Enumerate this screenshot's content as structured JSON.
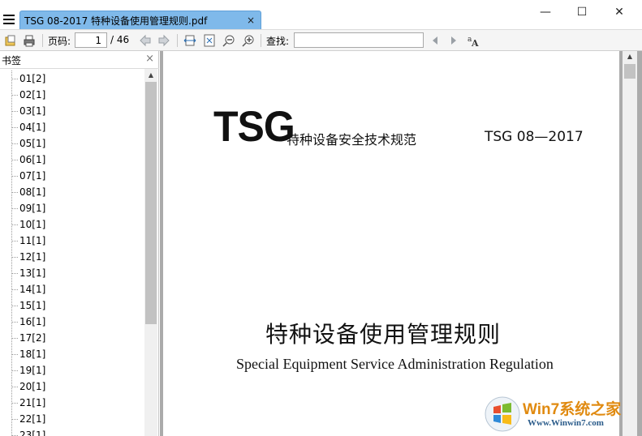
{
  "tab": {
    "title": "TSG 08-2017 特种设备使用管理规则.pdf",
    "close": "×"
  },
  "window": {
    "minimize": "—",
    "maximize": "☐",
    "close": "✕"
  },
  "toolbar": {
    "page_label": "页码:",
    "page_value": "1",
    "page_total": "/ 46",
    "find_label": "查找:",
    "find_value": ""
  },
  "sidebar": {
    "title": "书签",
    "close": "×",
    "bookmarks": [
      "01[2]",
      "02[1]",
      "03[1]",
      "04[1]",
      "05[1]",
      "06[1]",
      "07[1]",
      "08[1]",
      "09[1]",
      "10[1]",
      "11[1]",
      "12[1]",
      "13[1]",
      "14[1]",
      "15[1]",
      "16[1]",
      "17[2]",
      "18[1]",
      "19[1]",
      "20[1]",
      "21[1]",
      "22[1]",
      "23[1]"
    ]
  },
  "document": {
    "logo": "TSG",
    "standard_name": "特种设备安全技术规范",
    "standard_code": "TSG 08—2017",
    "title": "特种设备使用管理规则",
    "subtitle": "Special Equipment Service Administration Regulation"
  },
  "watermark": {
    "text": "Win7系统之家",
    "url": "Www.Winwin7.com"
  },
  "colors": {
    "tab": "#7fb9ea",
    "toolbar": "#f5f5f5",
    "doc_background": "#ababab",
    "watermark": "#e08a10"
  },
  "scroll": {
    "sidebar_thumb_fraction": 0.68
  }
}
